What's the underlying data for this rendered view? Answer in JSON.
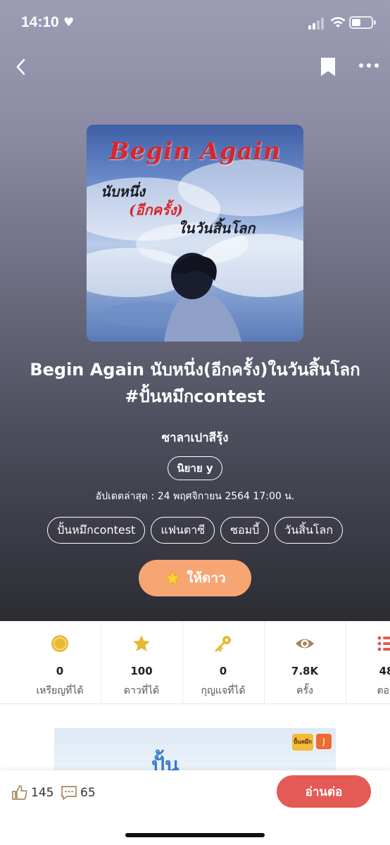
{
  "status_bar": {
    "time": "14:10",
    "heart": "♥"
  },
  "nav": {
    "back_icon": "chevron-left-icon",
    "bookmark_icon": "bookmark-icon",
    "more_icon": "more-horizontal-icon"
  },
  "cover": {
    "title": "Begin Again",
    "subtitle_line1": "นับหนึ่ง",
    "subtitle_line2": "(อีกครั้ง)",
    "subtitle_line3": "ในวันสิ้นโลก"
  },
  "book": {
    "title": "Begin Again นับหนึ่ง(อีกครั้ง)ในวันสิ้นโลก #ปั้นหมึกcontest",
    "author": "ซาลาเปาสีรุ้ง",
    "category": "นิยาย y",
    "updated": "อัปเดตล่าสุด :  24 พฤศจิกายน 2564 17:00 น.",
    "tags": [
      "ปั้นหมึกcontest",
      "แฟนตาซี",
      "ซอมบี้",
      "วันสิ้นโลก"
    ],
    "star_button": "ให้ดาว"
  },
  "stats": [
    {
      "icon": "coin-icon",
      "value": "0",
      "label": "เหรียญที่ได้"
    },
    {
      "icon": "star-icon",
      "value": "100",
      "label": "ดาวที่ได้"
    },
    {
      "icon": "key-icon",
      "value": "0",
      "label": "กุญแจที่ได้"
    },
    {
      "icon": "eye-icon",
      "value": "7.8K",
      "label": "ครั้ง"
    },
    {
      "icon": "list-icon",
      "value": "48",
      "label": "ตอน"
    }
  ],
  "banner": {
    "word": "ปั้น",
    "badge1": "ปั้นหมึก",
    "badge2": "J"
  },
  "bottom_bar": {
    "likes": "145",
    "comments": "65",
    "read_button": "อ่านต่อ"
  },
  "colors": {
    "accent": "#e45a55",
    "star_button": "#f8a574",
    "icon_gold": "#e8b835",
    "eye": "#a9865a",
    "list_red": "#e45a55"
  }
}
